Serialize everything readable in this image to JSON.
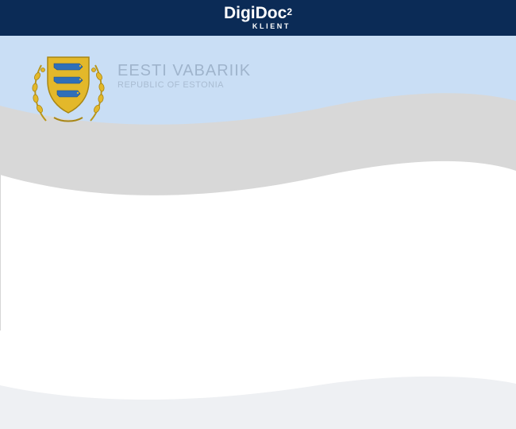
{
  "app": {
    "brand_main": "DigiDoc",
    "brand_sup": "2",
    "brand_sub": "KLIENT"
  },
  "banner": {
    "title": "EESTI VABARIIK",
    "subtitle": "REPUBLIC OF ESTONIA"
  },
  "colors": {
    "header_bg": "#0b2b56",
    "sky_blue": "#c9def5",
    "wave_gray": "#d8d8d8",
    "bottom_wave": "#eef0f3",
    "coat_gold": "#e3b82a",
    "coat_blue": "#2f6fb8"
  },
  "icons": {
    "coat_of_arms": "estonia-coat-of-arms-icon"
  }
}
